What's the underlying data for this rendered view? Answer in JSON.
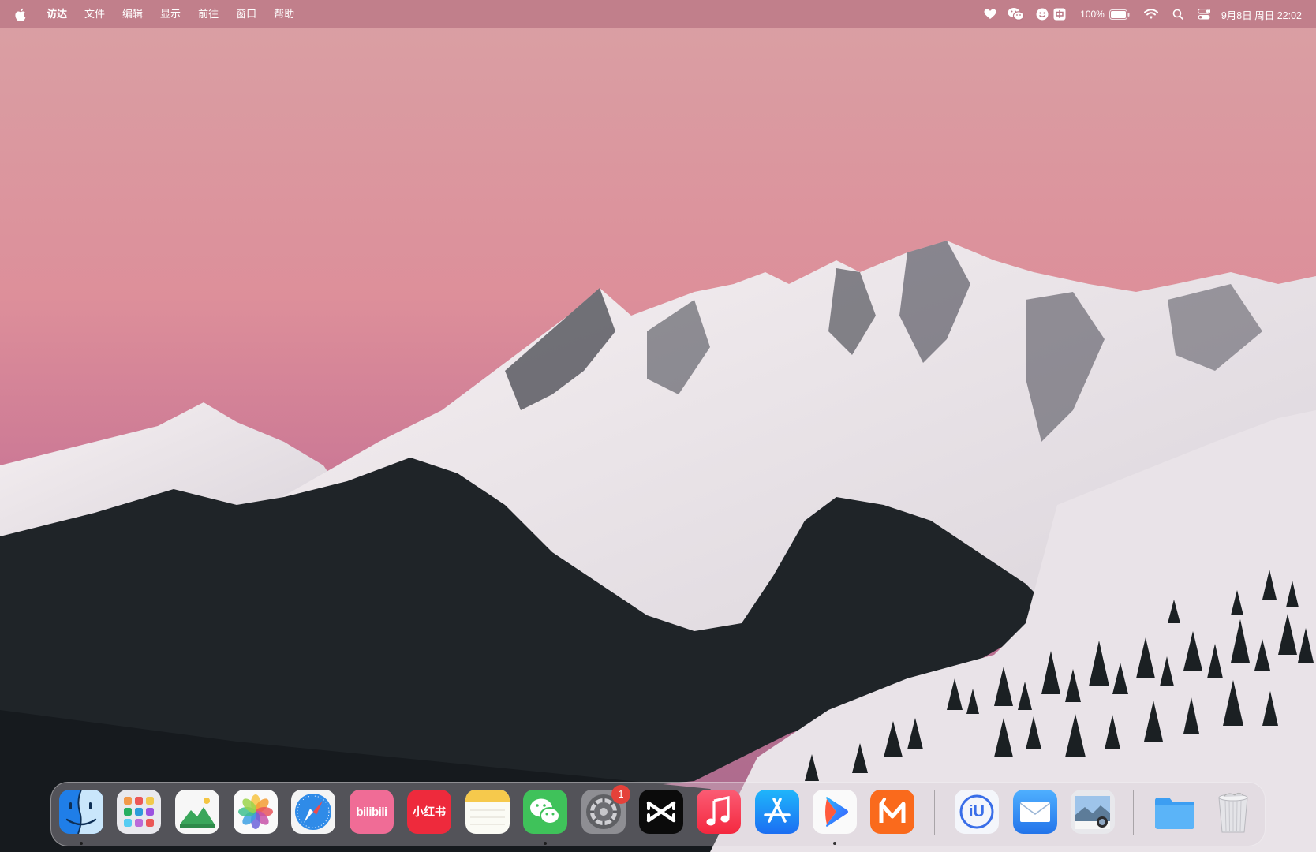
{
  "menubar": {
    "app_name": "访达",
    "menus": [
      "文件",
      "编辑",
      "显示",
      "前往",
      "窗口",
      "帮助"
    ],
    "battery_percent": "100%",
    "datetime": "9月8日 周日 22:02",
    "status_icons": [
      "heart-icon",
      "wechat-icon",
      "face-icon",
      "input-method-icon",
      "battery-icon",
      "wifi-icon",
      "search-icon",
      "control-center-icon"
    ]
  },
  "dock": {
    "apps": [
      {
        "name": "访达",
        "icon": "finder-icon",
        "running": true
      },
      {
        "name": "启动台",
        "icon": "launchpad-icon",
        "running": false
      },
      {
        "name": "预览",
        "icon": "preview-landscape-icon",
        "running": false
      },
      {
        "name": "照片",
        "icon": "photos-icon",
        "running": false
      },
      {
        "name": "Safari",
        "icon": "safari-icon",
        "running": false
      },
      {
        "name": "哔哩哔哩",
        "icon": "bilibili-icon",
        "label": "bilibili",
        "running": false
      },
      {
        "name": "小红书",
        "icon": "xiaohongshu-icon",
        "label": "小红书",
        "running": false
      },
      {
        "name": "备忘录",
        "icon": "notes-icon",
        "running": false
      },
      {
        "name": "微信",
        "icon": "wechat-icon",
        "running": true
      },
      {
        "name": "系统设置",
        "icon": "settings-icon",
        "running": false,
        "badge": "1"
      },
      {
        "name": "剪映",
        "icon": "capcut-icon",
        "running": false
      },
      {
        "name": "音乐",
        "icon": "music-icon",
        "running": false
      },
      {
        "name": "App Store",
        "icon": "app-store-icon",
        "running": false
      },
      {
        "name": "播放器",
        "icon": "play-icon",
        "running": true
      },
      {
        "name": "芒果TV",
        "icon": "mango-tv-icon",
        "running": false
      },
      {
        "name": "iU",
        "icon": "iu-icon",
        "label": "iU",
        "running": false
      },
      {
        "name": "邮件",
        "icon": "mail-icon",
        "running": false
      },
      {
        "name": "预览",
        "icon": "preview-icon",
        "running": false
      },
      {
        "name": "下载",
        "icon": "folder-icon",
        "running": false
      },
      {
        "name": "废纸篓",
        "icon": "trash-icon",
        "running": false
      }
    ]
  },
  "colors": {
    "sky_top": "#d99aa0",
    "sky_bottom": "#c77b95",
    "forest": "#1d2226",
    "snow": "#f2ecef"
  }
}
